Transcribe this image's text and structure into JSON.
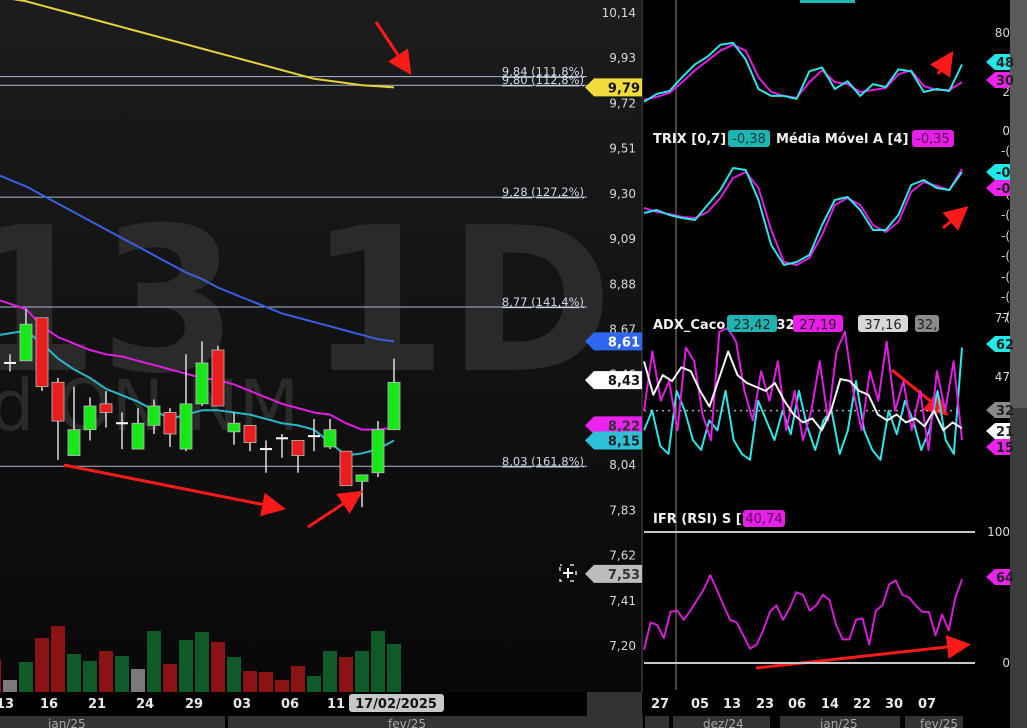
{
  "colors": {
    "up": "#19e619",
    "down": "#e61e1e",
    "ma_magenta": "#e01ee0",
    "ma_cyan": "#26b8c8",
    "ma_blue": "#3a5fe0",
    "ma_yellow": "#e6d23c",
    "fib": "#aab8d0",
    "arrow": "#ff1a1a",
    "vol_up": "#0f5a28",
    "vol_down": "#8a1414",
    "vol_neutral": "#7a7a7a"
  },
  "watermark": {
    "symbol": "13 1D",
    "subtitle": "d ON NM"
  },
  "main_chart": {
    "price_axis": [
      "10,14",
      "9,93",
      "9,72",
      "9,51",
      "9,30",
      "9,09",
      "8,88",
      "8,67",
      "8,46",
      "8,04",
      "7,83",
      "7,62",
      "7,41",
      "7,20"
    ],
    "price_axis_values": [
      10.14,
      9.93,
      9.72,
      9.51,
      9.3,
      9.09,
      8.88,
      8.67,
      8.46,
      8.04,
      7.83,
      7.62,
      7.41,
      7.2
    ],
    "fib_levels": [
      {
        "price": 9.84,
        "label": "9,84 (111,8%)"
      },
      {
        "price": 9.8,
        "label": "9,80 (112,8%)"
      },
      {
        "price": 9.28,
        "label": "9,28 (127,2%)"
      },
      {
        "price": 8.77,
        "label": "8,77 (141,4%)"
      },
      {
        "price": 8.03,
        "label": "8,03 (161,8%)"
      }
    ],
    "tags": [
      {
        "label": "9,79",
        "price": 9.79,
        "bg": "#f0dc3c",
        "fg": "#111"
      },
      {
        "label": "8,61",
        "price": 8.61,
        "bg": "#2f66f0",
        "fg": "#fff"
      },
      {
        "label": "8,43",
        "price": 8.43,
        "bg": "#ffffff",
        "fg": "#111"
      },
      {
        "label": "8,22",
        "price": 8.22,
        "bg": "#ee22ee",
        "fg": "#333"
      },
      {
        "label": "8,15",
        "price": 8.15,
        "bg": "#2ec0d6",
        "fg": "#222"
      },
      {
        "label": "7,53",
        "price": 7.53,
        "bg": "#bdbdbd",
        "fg": "#333"
      }
    ],
    "candles": [
      {
        "o": 8.51,
        "c": 8.51,
        "h": 8.55,
        "l": 8.47
      },
      {
        "o": 8.52,
        "c": 8.69,
        "h": 8.76,
        "l": 8.52
      },
      {
        "o": 8.72,
        "c": 8.4,
        "h": 8.72,
        "l": 8.38
      },
      {
        "o": 8.42,
        "c": 8.24,
        "h": 8.44,
        "l": 8.06
      },
      {
        "o": 8.08,
        "c": 8.2,
        "h": 8.4,
        "l": 8.08
      },
      {
        "o": 8.2,
        "c": 8.31,
        "h": 8.35,
        "l": 8.15
      },
      {
        "o": 8.32,
        "c": 8.28,
        "h": 8.38,
        "l": 8.21
      },
      {
        "o": 8.23,
        "c": 8.23,
        "h": 8.28,
        "l": 8.11
      },
      {
        "o": 8.11,
        "c": 8.23,
        "h": 8.3,
        "l": 8.11
      },
      {
        "o": 8.22,
        "c": 8.31,
        "h": 8.34,
        "l": 8.18
      },
      {
        "o": 8.28,
        "c": 8.18,
        "h": 8.3,
        "l": 8.12
      },
      {
        "o": 8.11,
        "c": 8.32,
        "h": 8.55,
        "l": 8.1
      },
      {
        "o": 8.32,
        "c": 8.51,
        "h": 8.61,
        "l": 8.31
      },
      {
        "o": 8.57,
        "c": 8.31,
        "h": 8.59,
        "l": 8.31
      },
      {
        "o": 8.19,
        "c": 8.23,
        "h": 8.28,
        "l": 8.13
      },
      {
        "o": 8.22,
        "c": 8.14,
        "h": 8.22,
        "l": 8.1
      },
      {
        "o": 8.11,
        "c": 8.11,
        "h": 8.15,
        "l": 8.0
      },
      {
        "o": 8.16,
        "c": 8.16,
        "h": 8.18,
        "l": 8.07
      },
      {
        "o": 8.15,
        "c": 8.08,
        "h": 8.15,
        "l": 8.0
      },
      {
        "o": 8.17,
        "c": 8.17,
        "h": 8.25,
        "l": 8.1
      },
      {
        "o": 8.12,
        "c": 8.2,
        "h": 8.25,
        "l": 8.11
      },
      {
        "o": 8.1,
        "c": 7.94,
        "h": 8.1,
        "l": 7.94
      },
      {
        "o": 7.96,
        "c": 7.99,
        "h": 7.99,
        "l": 7.84
      },
      {
        "o": 8.0,
        "c": 8.2,
        "h": 8.24,
        "l": 7.98
      },
      {
        "o": 8.2,
        "c": 8.42,
        "h": 8.53,
        "l": 8.2
      }
    ],
    "ma_magenta": [
      8.8,
      8.76,
      8.68,
      8.63,
      8.6,
      8.57,
      8.55,
      8.54,
      8.52,
      8.5,
      8.48,
      8.46,
      8.44,
      8.43,
      8.41,
      8.38,
      8.35,
      8.32,
      8.3,
      8.28,
      8.27,
      8.23,
      8.2,
      8.2,
      8.21
    ],
    "ma_cyan": [
      8.64,
      8.66,
      8.6,
      8.53,
      8.48,
      8.44,
      8.39,
      8.36,
      8.33,
      8.29,
      8.25,
      8.27,
      8.29,
      8.29,
      8.28,
      8.27,
      8.25,
      8.23,
      8.22,
      8.2,
      8.14,
      8.08,
      8.09,
      8.11,
      8.15
    ],
    "ma_blue": [
      9.38,
      9.33,
      9.29,
      9.25,
      9.21,
      9.17,
      9.13,
      9.09,
      9.05,
      9.01,
      8.97,
      8.93,
      8.9,
      8.86,
      8.83,
      8.8,
      8.77,
      8.74,
      8.72,
      8.7,
      8.68,
      8.66,
      8.64,
      8.62,
      8.61
    ],
    "ma_yellow": [
      10.21,
      10.19,
      10.17,
      10.15,
      10.13,
      10.11,
      10.09,
      10.07,
      10.05,
      10.03,
      10.01,
      9.99,
      9.97,
      9.95,
      9.93,
      9.91,
      9.89,
      9.87,
      9.85,
      9.83,
      9.82,
      9.81,
      9.8,
      9.795,
      9.79
    ],
    "volume": [
      {
        "v": 33,
        "dir": "down"
      },
      {
        "v": 12,
        "dir": "neutral"
      },
      {
        "v": 30,
        "dir": "up"
      },
      {
        "v": 54,
        "dir": "down"
      },
      {
        "v": 66,
        "dir": "down"
      },
      {
        "v": 38,
        "dir": "up"
      },
      {
        "v": 31,
        "dir": "up"
      },
      {
        "v": 41,
        "dir": "down"
      },
      {
        "v": 36,
        "dir": "up"
      },
      {
        "v": 23,
        "dir": "neutral"
      },
      {
        "v": 61,
        "dir": "up"
      },
      {
        "v": 28,
        "dir": "down"
      },
      {
        "v": 52,
        "dir": "up"
      },
      {
        "v": 60,
        "dir": "up"
      },
      {
        "v": 50,
        "dir": "down"
      },
      {
        "v": 35,
        "dir": "up"
      },
      {
        "v": 21,
        "dir": "down"
      },
      {
        "v": 20,
        "dir": "down"
      },
      {
        "v": 12,
        "dir": "down"
      },
      {
        "v": 26,
        "dir": "down"
      },
      {
        "v": 16,
        "dir": "up"
      },
      {
        "v": 41,
        "dir": "up"
      },
      {
        "v": 35,
        "dir": "down"
      },
      {
        "v": 41,
        "dir": "up"
      },
      {
        "v": 61,
        "dir": "up"
      },
      {
        "v": 48,
        "dir": "up"
      }
    ],
    "date_labels": [
      "13",
      "16",
      "21",
      "24",
      "29",
      "03",
      "06",
      "11"
    ],
    "current_date": "17/02/2025",
    "months": [
      "jan/25",
      "fev/25"
    ]
  },
  "right_panel": {
    "stoch": {
      "axis": [
        "80",
        "2"
      ],
      "tags": [
        {
          "label": "48",
          "bg": "#22e8e8"
        },
        {
          "label": "30",
          "bg": "#ee22ee"
        }
      ],
      "k": [
        10,
        18,
        21,
        35,
        48,
        56,
        68,
        70,
        53,
        23,
        16,
        16,
        13,
        41,
        45,
        23,
        31,
        16,
        28,
        25,
        43,
        41,
        20,
        23,
        21,
        48
      ],
      "d": [
        12,
        15,
        19,
        30,
        42,
        52,
        62,
        68,
        62,
        35,
        20,
        16,
        14,
        30,
        42,
        30,
        28,
        20,
        22,
        24,
        38,
        42,
        26,
        22,
        22,
        30
      ]
    },
    "trix": {
      "title": "TRIX [0,7]",
      "value": "-0,38",
      "ma_title": "Média Móvel A [4]",
      "ma_value": "-0,35",
      "axis": [
        "0",
        "-(",
        "-(",
        "-(",
        "-(",
        "-(",
        "-(",
        "-(",
        "-("
      ],
      "tags": [
        {
          "label": "-0",
          "bg": "#22e8e8"
        },
        {
          "label": "-0",
          "bg": "#ee22ee"
        }
      ],
      "line": [
        -0.79,
        -0.76,
        -0.81,
        -0.84,
        -0.86,
        -0.71,
        -0.56,
        -0.34,
        -0.36,
        -0.66,
        -1.11,
        -1.31,
        -1.28,
        -1.21,
        -0.91,
        -0.66,
        -0.63,
        -0.76,
        -0.96,
        -0.96,
        -0.81,
        -0.51,
        -0.46,
        -0.54,
        -0.56,
        -0.38
      ],
      "ma": [
        -0.74,
        -0.78,
        -0.8,
        -0.83,
        -0.84,
        -0.78,
        -0.64,
        -0.44,
        -0.38,
        -0.54,
        -0.96,
        -1.28,
        -1.31,
        -1.24,
        -1.01,
        -0.71,
        -0.64,
        -0.71,
        -0.91,
        -0.98,
        -0.88,
        -0.58,
        -0.48,
        -0.52,
        -0.56,
        -0.35
      ]
    },
    "adx": {
      "title": "ADX_Caco [3 8 3 32]",
      "values": [
        {
          "label": "23,42",
          "bg": "#1fb4b4"
        },
        {
          "label": "27,19",
          "bg": "#e61ee6"
        },
        {
          "label": "37,16",
          "bg": "#d8d8d8"
        },
        {
          "label": "32,",
          "bg": "#8a8a8a"
        }
      ],
      "axis": [
        "77",
        "47"
      ],
      "threshold": 32,
      "tags": [
        {
          "label": "62",
          "bg": "#22e8e8",
          "v": 62
        },
        {
          "label": "32",
          "bg": "#8a8a8a",
          "v": 32
        },
        {
          "label": "21",
          "bg": "#ffffff",
          "v": 21
        },
        {
          "label": "15",
          "bg": "#ee22ee",
          "v": 15
        }
      ],
      "cyan": [
        20,
        30,
        12,
        8,
        40,
        30,
        15,
        10,
        25,
        20,
        40,
        15,
        8,
        5,
        35,
        25,
        15,
        30,
        18,
        40,
        22,
        10,
        25,
        30,
        8,
        20,
        45,
        20,
        10,
        5,
        30,
        18,
        35,
        25,
        10,
        20,
        40,
        15,
        8,
        62
      ],
      "magenta": [
        30,
        60,
        35,
        45,
        20,
        62,
        55,
        28,
        15,
        70,
        72,
        65,
        40,
        25,
        50,
        35,
        55,
        20,
        40,
        15,
        30,
        55,
        25,
        60,
        70,
        40,
        20,
        50,
        35,
        65,
        30,
        45,
        20,
        40,
        10,
        50,
        30,
        55,
        15
      ],
      "white": [
        55,
        38,
        48,
        45,
        52,
        50,
        40,
        32,
        46,
        60,
        48,
        44,
        42,
        40,
        44,
        35,
        28,
        24,
        26,
        20,
        30,
        46,
        45,
        40,
        38,
        28,
        25,
        28,
        24,
        26,
        22,
        30,
        20,
        24,
        21
      ]
    },
    "rsi": {
      "title": "IFR (RSI) S [7]",
      "value": "40,74",
      "axis": [
        "100",
        "0"
      ],
      "tags": [
        {
          "label": "64",
          "bg": "#ee22ee"
        }
      ],
      "line": [
        10,
        31,
        29,
        19,
        39,
        40,
        33,
        40,
        48,
        56,
        67,
        56,
        44,
        33,
        31,
        21,
        11,
        14,
        25,
        39,
        44,
        33,
        42,
        54,
        52,
        40,
        44,
        52,
        48,
        29,
        18,
        18,
        33,
        34,
        14,
        40,
        44,
        60,
        63,
        52,
        50,
        44,
        39,
        39,
        21,
        37,
        25,
        50,
        64
      ]
    },
    "date_labels": [
      "27",
      "05",
      "13",
      "23",
      "06",
      "14",
      "22",
      "30",
      "07"
    ],
    "months": [
      "dez/24",
      "jan/25",
      "fev/25"
    ]
  }
}
